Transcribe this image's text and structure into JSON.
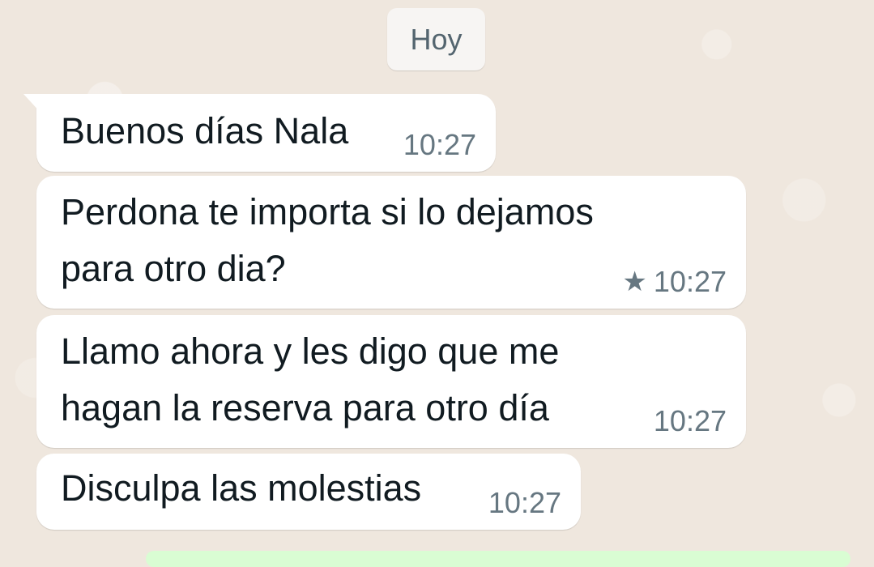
{
  "chat": {
    "date_chip": "Hoy",
    "messages": [
      {
        "text": "Buenos días Nala",
        "time": "10:27",
        "starred": false
      },
      {
        "text": "Perdona te importa si lo dejamos\npara otro dia?",
        "time": "10:27",
        "starred": true
      },
      {
        "text": "Llamo ahora y les digo que me\nhagan la reserva para otro día",
        "time": "10:27",
        "starred": false
      },
      {
        "text": "Disculpa las molestias",
        "time": "10:27",
        "starred": false
      }
    ],
    "star_icon": "★"
  },
  "colors": {
    "wallpaper": "#efe7de",
    "incoming_bubble": "#ffffff",
    "outgoing_bubble": "#d9fdd3",
    "meta_text": "#667781"
  }
}
